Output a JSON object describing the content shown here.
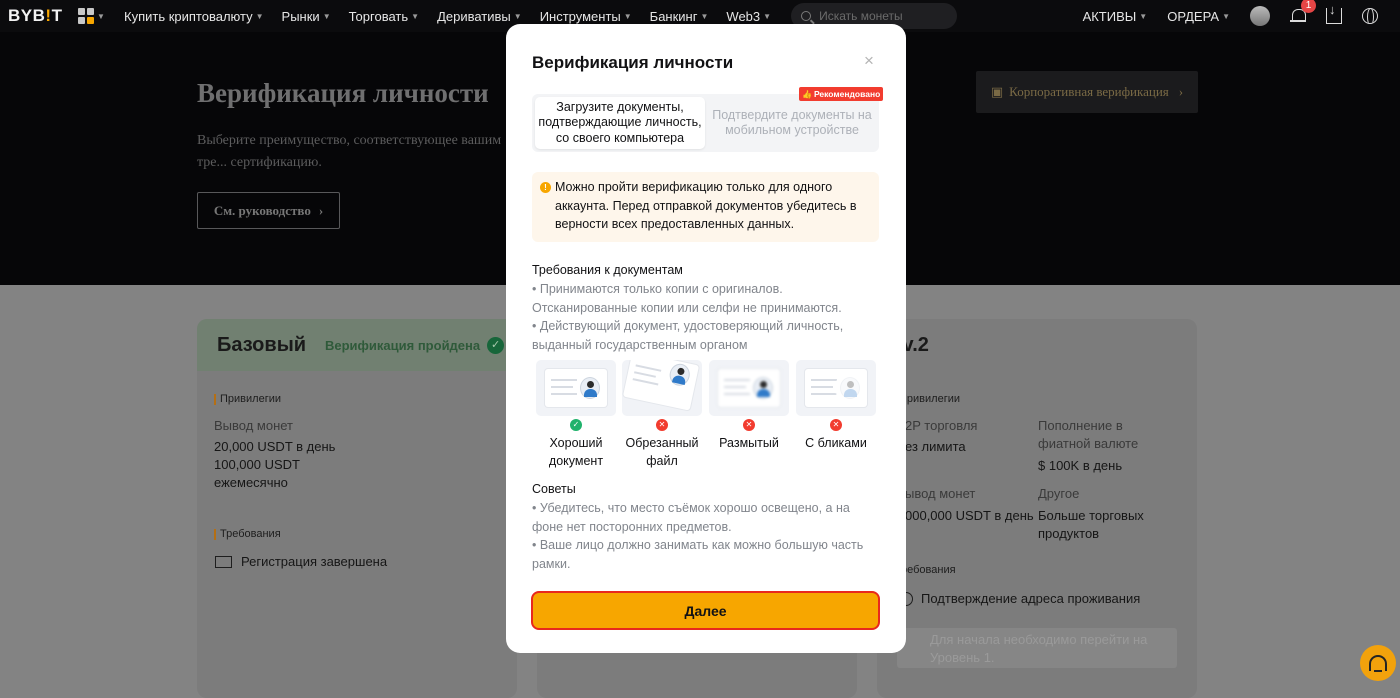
{
  "nav": {
    "logo": "BYB!T",
    "items": [
      "Купить криптовалюту",
      "Рынки",
      "Торговать",
      "Деривативы",
      "Инструменты",
      "Банкинг",
      "Web3"
    ],
    "search_placeholder": "Искать монеты",
    "assets": "АКТИВЫ",
    "orders": "ОРДЕРА",
    "notif_count": "1",
    "icons": [
      "apps-grid-icon",
      "search-icon",
      "avatar",
      "bell-icon",
      "download-icon",
      "globe-icon"
    ]
  },
  "hero": {
    "title": "Верификация личности",
    "subtitle": "Выберите преимущество, соответствующее вашим тре... сертификацию.",
    "guide_button": "См. руководство",
    "corp_button": "Корпоративная верификация"
  },
  "cards": {
    "basic": {
      "title": "Базовый",
      "status": "Верификация пройдена",
      "privileges": "Привилегии",
      "withdraw_label": "Вывод монет",
      "withdraw_value": "20,000 USDT в день 100,000 USDT ежемесячно",
      "requirements": "Требования",
      "req_item": "Регистрация завершена"
    },
    "lv2": {
      "title": ".v.2",
      "privileges": "Привилегии",
      "p2p_label": "2P торговля",
      "p2p_value": "ез лимита",
      "fiat_label": "Пополнение в фиатной валюте",
      "fiat_value": "$ 100K в день",
      "withdraw_label": "ывод монет",
      "withdraw_value": "000,000 USDT в день",
      "other_label": "Другое",
      "other_value": "Больше торговых продуктов",
      "requirements": "ребования",
      "req_item": "Подтверждение адреса проживания",
      "note": "Для начала необходимо перейти на Уровень 1."
    }
  },
  "modal": {
    "title": "Верификация личности",
    "close": "×",
    "tab_upload": "Загрузите документы, подтверждающие личность, со своего компьютера",
    "tab_mobile": "Подтвердите документы на мобильном устройстве",
    "recommended": "Рекомендовано",
    "warning": "Можно пройти верификацию только для одного аккаунта. Перед отправкой документов убедитесь в верности всех предоставленных данных.",
    "requirements_title": "Требования к документам",
    "requirements": [
      "• Принимаются только копии с оригиналов. Отсканированные копии или селфи не принимаются.",
      "• Действующий документ, удостоверяющий личность, выданный государственным органом"
    ],
    "examples": [
      {
        "label": "Хороший документ",
        "status": "ok"
      },
      {
        "label": "Обрезанный файл",
        "status": "bad"
      },
      {
        "label": "Размытый",
        "status": "bad"
      },
      {
        "label": "С бликами",
        "status": "bad"
      }
    ],
    "tips_title": "Советы",
    "tips": [
      "• Убедитесь, что место съёмок хорошо освещено, а на фоне нет посторонних предметов.",
      "• Ваше лицо должно занимать как можно большую часть рамки."
    ],
    "next_button": "Далее"
  },
  "colors": {
    "accent": "#f7a600",
    "danger": "#f23c2f",
    "success": "#20b26c"
  }
}
